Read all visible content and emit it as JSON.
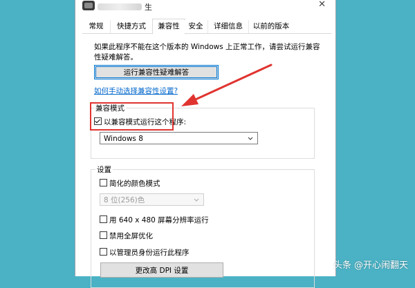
{
  "window": {
    "title_suffix": "生",
    "close_glyph": "✕"
  },
  "tabs": [
    {
      "label": "常规"
    },
    {
      "label": "快捷方式"
    },
    {
      "label": "兼容性",
      "active": true
    },
    {
      "label": "安全"
    },
    {
      "label": "详细信息"
    },
    {
      "label": "以前的版本"
    }
  ],
  "compat_page": {
    "description": "如果此程序不能在这个版本的 Windows 上正常工作，请尝试运行兼容性疑难解答。",
    "troubleshooter_button": "运行兼容性疑难解答",
    "manual_link": "如何手动选择兼容性设置?",
    "compat_mode": {
      "legend": "兼容模式",
      "run_in_compat_label": "以兼容模式运行这个程序:",
      "run_in_compat_checked": true,
      "os_selected": "Windows 8"
    },
    "settings": {
      "legend": "设置",
      "reduced_color_label": "简化的颜色模式",
      "reduced_color_checked": false,
      "color_mode_selected": "8 位(256)色",
      "resolution_label": "用 640 x 480 屏幕分辨率运行",
      "resolution_checked": false,
      "disable_fullscreen_label": "禁用全屏优化",
      "disable_fullscreen_checked": false,
      "run_as_admin_label": "以管理员身份运行此程序",
      "run_as_admin_checked": false,
      "dpi_button": "更改高 DPI 设置"
    }
  },
  "watermark": "头条 @开心闹翻天",
  "colors": {
    "desktop_bg": "#4bb2c5",
    "annotation_red": "#e0332f",
    "link_blue": "#0066cc",
    "focus_blue": "#0078d7"
  },
  "icons": [
    "app-icon",
    "close-icon",
    "chevron-down-icon",
    "checkbox-check-icon",
    "annotation-arrow"
  ]
}
